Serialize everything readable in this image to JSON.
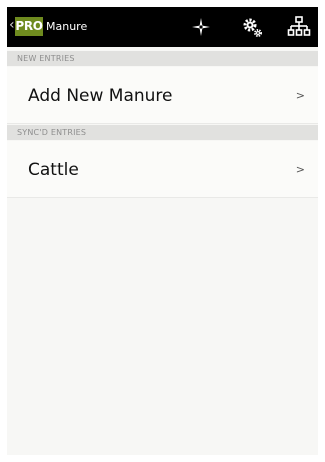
{
  "action_bar": {
    "back_glyph": "‹",
    "logo_text": "PRO",
    "title": "Manure",
    "icons": [
      "compass-icon",
      "settings-icon",
      "sitemap-icon"
    ],
    "logo_color": "#6f8b1f",
    "background_color": "#000000"
  },
  "sections": [
    {
      "header": "NEW ENTRIES",
      "items": [
        {
          "label": "Add New Manure",
          "chevron": ">"
        }
      ]
    },
    {
      "header": "SYNC'D ENTRIES",
      "items": [
        {
          "label": "Cattle",
          "chevron": ">"
        }
      ]
    }
  ]
}
